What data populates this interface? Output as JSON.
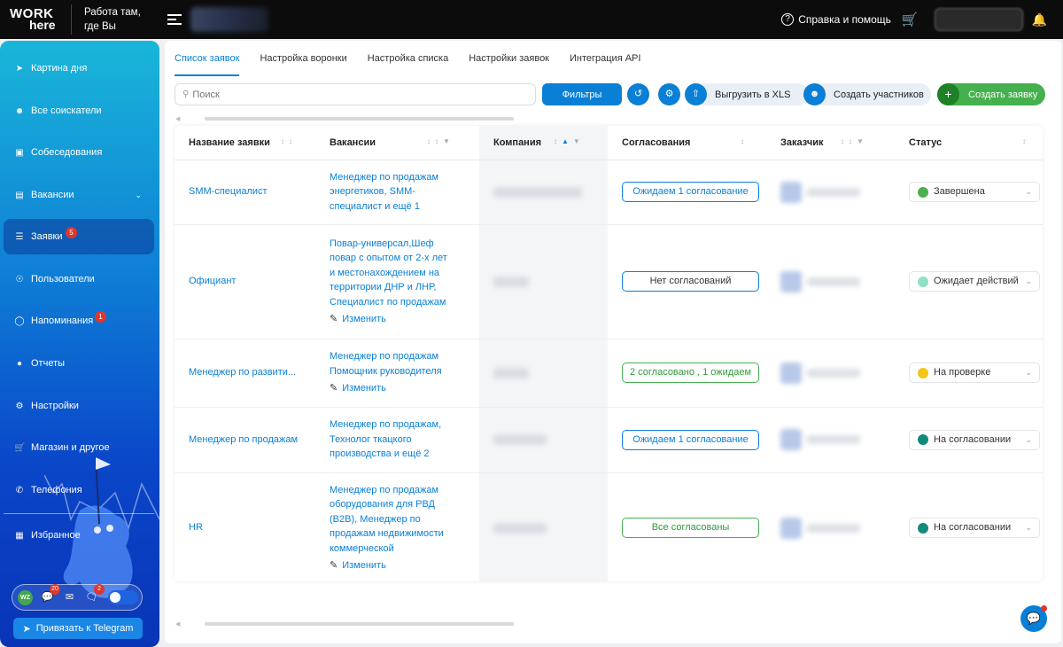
{
  "header": {
    "logo_line1": "WORK",
    "logo_line2": "here",
    "tagline_line1": "Работа там,",
    "tagline_line2": "где Вы",
    "help_label": "Справка и помощь"
  },
  "sidebar": {
    "items": [
      {
        "label": "Картина дня",
        "icon": "rocket-icon"
      },
      {
        "label": "Все соискатели",
        "icon": "users-icon"
      },
      {
        "label": "Собеседования",
        "icon": "calendar-icon"
      },
      {
        "label": "Вакансии",
        "icon": "briefcase-icon"
      },
      {
        "label": "Заявки",
        "icon": "list-icon",
        "badge": "5"
      },
      {
        "label": "Пользователи",
        "icon": "user-icon"
      },
      {
        "label": "Напоминания",
        "icon": "bell-icon",
        "badge": "1"
      },
      {
        "label": "Отчеты",
        "icon": "report-icon"
      },
      {
        "label": "Настройки",
        "icon": "gear-icon"
      },
      {
        "label": "Магазин и другое",
        "icon": "cart-icon"
      },
      {
        "label": "Телефония",
        "icon": "phone-icon"
      },
      {
        "label": "Избранное",
        "icon": "grid-icon"
      }
    ],
    "bottom": {
      "wz_label": "WZ",
      "chat_badge": "20",
      "messages_badge": "2"
    },
    "telegram_button": "Привязать к Telegram"
  },
  "tabs": [
    "Список заявок",
    "Настройка воронки",
    "Настройка списка",
    "Настройки заявок",
    "Интеграция API"
  ],
  "toolbar": {
    "search_placeholder": "Поиск",
    "filter_label": "Фильтры",
    "export_label": "Выгрузить в XLS",
    "create_members_label": "Создать участников",
    "create_request_label": "Создать заявку"
  },
  "table": {
    "columns": [
      "Название заявки",
      "Вакансии",
      "Компания",
      "Согласования",
      "Заказчик",
      "Статус"
    ],
    "edit_label": "Изменить",
    "rows": [
      {
        "name": "SMM-специалист",
        "vacancies": [
          "Менеджер по продажам",
          "энергетиков, SMM-",
          "специалист и ещё 1"
        ],
        "edit": false,
        "approval": "Ожидаем 1 согласование",
        "approval_style": "blue",
        "status": "Завершена",
        "status_color": "#4caf50"
      },
      {
        "name": "Официант",
        "vacancies": [
          "Повар-универсал,Шеф",
          "повар с опытом от 2-х лет",
          "и местонахождением на",
          "территории ДНР и ЛНР,",
          "Специалист по продажам"
        ],
        "edit": true,
        "approval": "Нет согласований",
        "approval_style": "gray",
        "status": "Ожидает действий",
        "status_color": "#8fe0c6"
      },
      {
        "name": "Менеджер по развити...",
        "vacancies": [
          "Менеджер по продажам",
          "Помощник руководителя"
        ],
        "edit": true,
        "approval": "2 согласовано , 1 ожидаем",
        "approval_style": "green",
        "status": "На проверке",
        "status_color": "#f5c518"
      },
      {
        "name": "Менеджер по продажам",
        "vacancies": [
          "Менеджер по продажам,",
          "Технолог ткацкого",
          "производства и ещё 2"
        ],
        "edit": false,
        "approval": "Ожидаем 1 согласование",
        "approval_style": "blue",
        "status": "На согласовании",
        "status_color": "#138a7a"
      },
      {
        "name": "HR",
        "vacancies": [
          "Менеджер по продажам",
          "оборудования для РВД",
          "(B2B), Менеджер по",
          "продажам недвижимости",
          "коммерческой"
        ],
        "edit": true,
        "approval": "Все согласованы",
        "approval_style": "green",
        "status": "На согласовании",
        "status_color": "#138a7a"
      }
    ]
  }
}
